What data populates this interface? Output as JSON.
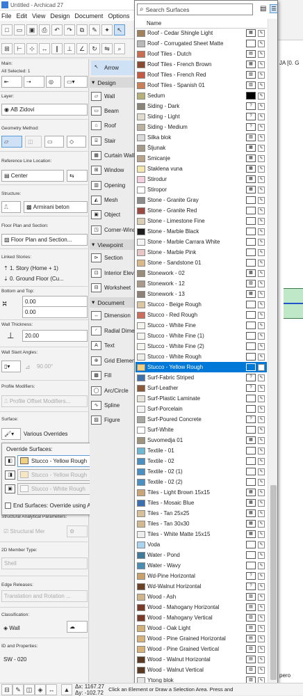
{
  "app": {
    "title": "Untitled - Archicad 27",
    "menus": [
      "File",
      "Edit",
      "View",
      "Design",
      "Document",
      "Options"
    ]
  },
  "info": {
    "main": "Main:",
    "all_selected": "All Selected: 1",
    "layer_label": "Layer:",
    "layer": "AB Zidovi",
    "geometry_label": "Geometry Method:",
    "refline_label": "Reference Line Location:",
    "refline": "Center",
    "structure_label": "Structure:",
    "structure": "Armirani beton",
    "floorplan_label": "Floor Plan and Section:",
    "floorplan": "Floor Plan and Section...",
    "linked_label": "Linked Stories:",
    "linked1": "1. Story (Home + 1)",
    "linked2": "0. Ground Floor (Cu...",
    "bottomtop_label": "Bottom and Top:",
    "top_value": "0.00",
    "bottom_value": "0.00",
    "thickness_label": "Wall Thickness:",
    "thickness": "20.00",
    "slant_label": "Wall Slant Angles:",
    "slant": "90.00°",
    "profile_label": "Profile Modifiers:",
    "profile": "Profile Offset Modifiers...",
    "surface_label": "Surface:",
    "surface": "Various Overrides",
    "structural_label": "Structural Analytical Parameters:",
    "structural": "Structural Member",
    "member2d_label": "2D Member Type:",
    "member2d": "Shell",
    "edge_label": "Edge Releases:",
    "edge": "Translation and Rotation ...",
    "class_label": "Classification:",
    "class": "Wall",
    "id_label": "ID and Properties:",
    "id": "SW - 020"
  },
  "overrides": {
    "title": "Override Surfaces:",
    "s1": "Stucco - Yellow Rough",
    "s2": "Stucco - Yellow Rough",
    "s3": "Stucco - White Rough",
    "end": "End Surfaces: Override using Adjoining Walls"
  },
  "toolbox": {
    "arrow": "Arrow",
    "design": "Design",
    "wall": "Wall",
    "beam": "Beam",
    "roof": "Roof",
    "stair": "Stair",
    "curtain": "Curtain Wall",
    "window": "Window",
    "opening": "Opening",
    "mesh": "Mesh",
    "object": "Object",
    "corner": "Corner-Window",
    "viewpoint": "Viewpoint",
    "section": "Section",
    "interior": "Interior Elevation",
    "worksheet": "Worksheet",
    "document": "Document",
    "dimension": "Dimension",
    "radial": "Radial Dimension",
    "text": "Text",
    "grid": "Grid Element",
    "fill": "Fill",
    "arc": "Arc/Circle",
    "spline": "Spline",
    "figure": "Figure"
  },
  "status": {
    "dx": "Δx: 1167.27",
    "dy": "Δy: -102.72",
    "message": "Click an Element or Draw a Selection Area. Press and"
  },
  "right": {
    "ja": "JA [0. G",
    "pero": "pero"
  },
  "surfaces": {
    "placeholder": "Search Surfaces",
    "header": "Name",
    "items": [
      {
        "name": "Roof - Cedar Shingle Light",
        "color": "#a0815b",
        "pattern": "▦"
      },
      {
        "name": "Roof - Corrugated Sheet Matte",
        "color": "#b9b9b9",
        "pattern": ""
      },
      {
        "name": "Roof Tiles - Dutch",
        "color": "#c86e50",
        "pattern": "▤"
      },
      {
        "name": "Roof Tiles - French Brown",
        "color": "#8a4a32",
        "pattern": "▦"
      },
      {
        "name": "Roof Tiles - French Red",
        "color": "#c25a45",
        "pattern": "▧"
      },
      {
        "name": "Roof Tiles - Spanish 01",
        "color": "#c9805b",
        "pattern": "▥"
      },
      {
        "name": "Sedum",
        "color": "#b5b07a",
        "pattern": "■"
      },
      {
        "name": "Siding - Dark",
        "color": "#8a8478",
        "pattern": "?"
      },
      {
        "name": "Siding - Light",
        "color": "#e0dccf",
        "pattern": "?"
      },
      {
        "name": "Siding - Medium",
        "color": "#b9b2a3",
        "pattern": "?"
      },
      {
        "name": "Silka blok",
        "color": "#d9d9d9",
        "pattern": "▨"
      },
      {
        "name": "Šljunak",
        "color": "#a59b8a",
        "pattern": "▩"
      },
      {
        "name": "Smicanje",
        "color": "#b8a48a",
        "pattern": "▦"
      },
      {
        "name": "Staklena vuna",
        "color": "#f4e8b0",
        "pattern": "▩"
      },
      {
        "name": "Stirodur",
        "color": "#f2d0e0",
        "pattern": "▦"
      },
      {
        "name": "Stiropor",
        "color": "#ffffff",
        "pattern": "▦"
      },
      {
        "name": "Stone - Granite Gray",
        "color": "#8c8c8c",
        "pattern": ""
      },
      {
        "name": "Stone - Granite Red",
        "color": "#9a4a42",
        "pattern": ""
      },
      {
        "name": "Stone - Limestone Fine",
        "color": "#d8cfb6",
        "pattern": ""
      },
      {
        "name": "Stone - Marble Black",
        "color": "#1e1e1e",
        "pattern": ""
      },
      {
        "name": "Stone - Marble Carrara White",
        "color": "#f4f4f4",
        "pattern": ""
      },
      {
        "name": "Stone - Marble Pink",
        "color": "#e8c6c6",
        "pattern": ""
      },
      {
        "name": "Stone - Sandstone 01",
        "color": "#d9b98a",
        "pattern": ""
      },
      {
        "name": "Stonework - 02",
        "color": "#9a8c7a",
        "pattern": "▩"
      },
      {
        "name": "Stonework - 12",
        "color": "#a89a8a",
        "pattern": "▧"
      },
      {
        "name": "Stonework - 13",
        "color": "#8d8275",
        "pattern": "▦"
      },
      {
        "name": "Stucco - Beige Rough",
        "color": "#d8c7a2",
        "pattern": ""
      },
      {
        "name": "Stucco - Red Rough",
        "color": "#c86e5a",
        "pattern": ""
      },
      {
        "name": "Stucco - White Fine",
        "color": "#f5f5f0",
        "pattern": ""
      },
      {
        "name": "Stucco - White Fine (1)",
        "color": "#f5f5f0",
        "pattern": ""
      },
      {
        "name": "Stucco - White Fine (2)",
        "color": "#f5f5f0",
        "pattern": ""
      },
      {
        "name": "Stucco - White Rough",
        "color": "#eeeeea",
        "pattern": ""
      },
      {
        "name": "Stucco - Yellow Rough",
        "color": "#f3cf82",
        "pattern": "",
        "selected": true
      },
      {
        "name": "Surf-Fabric Striped",
        "color": "#3f6fa8",
        "pattern": "?"
      },
      {
        "name": "Surf-Leather",
        "color": "#8a5a3a",
        "pattern": "?"
      },
      {
        "name": "Surf-Plastic Laminate",
        "color": "#e8e4dc",
        "pattern": ""
      },
      {
        "name": "Surf-Porcelain",
        "color": "#f3f3f3",
        "pattern": ""
      },
      {
        "name": "Surf-Poured Concrete",
        "color": "#a9a9a4",
        "pattern": "?"
      },
      {
        "name": "Surf-White",
        "color": "#ffffff",
        "pattern": ""
      },
      {
        "name": "Suvomedja 01",
        "color": "#9e9480",
        "pattern": "▦"
      },
      {
        "name": "Textile - 01",
        "color": "#6fb8d4",
        "pattern": ""
      },
      {
        "name": "Textile - 02",
        "color": "#4a8fc0",
        "pattern": ""
      },
      {
        "name": "Textile - 02 (1)",
        "color": "#4a8fc0",
        "pattern": ""
      },
      {
        "name": "Textile - 02 (2)",
        "color": "#4a8fc0",
        "pattern": ""
      },
      {
        "name": "Tiles - Light Brown 15x15",
        "color": "#c9a67a",
        "pattern": "▦"
      },
      {
        "name": "Tiles - Mosaic Blue",
        "color": "#3a6fb0",
        "pattern": "▩"
      },
      {
        "name": "Tiles - Tan 25x25",
        "color": "#d6bf99",
        "pattern": "▦"
      },
      {
        "name": "Tiles - Tan 30x30",
        "color": "#d2b890",
        "pattern": "▦"
      },
      {
        "name": "Tiles - White Matte 15x15",
        "color": "#eeeeee",
        "pattern": "▦"
      },
      {
        "name": "Voda",
        "color": "#a9d4f0",
        "pattern": ""
      },
      {
        "name": "Water - Pond",
        "color": "#3f7a9a",
        "pattern": ""
      },
      {
        "name": "Water - Wavy",
        "color": "#4a8bb0",
        "pattern": ""
      },
      {
        "name": "Wd-Pine Horizontal",
        "color": "#c8a06a",
        "pattern": "?"
      },
      {
        "name": "Wd-Walnut Horizontal",
        "color": "#6b4226",
        "pattern": "?"
      },
      {
        "name": "Wood - Ash",
        "color": "#cdb48c",
        "pattern": "▨"
      },
      {
        "name": "Wood - Mahogany Horizontal",
        "color": "#7a3a28",
        "pattern": "▤"
      },
      {
        "name": "Wood - Mahogany Vertical",
        "color": "#7a3a28",
        "pattern": "▥"
      },
      {
        "name": "Wood - Oak Light",
        "color": "#d2b07a",
        "pattern": "▤"
      },
      {
        "name": "Wood - Pine Grained Horizontal",
        "color": "#d6b27a",
        "pattern": "▤"
      },
      {
        "name": "Wood - Pine Grained Vertical",
        "color": "#d6b27a",
        "pattern": "▥"
      },
      {
        "name": "Wood - Walnut Horizontal",
        "color": "#5a3a22",
        "pattern": "▤"
      },
      {
        "name": "Wood - Walnut Vertical",
        "color": "#5a3a22",
        "pattern": "▥"
      },
      {
        "name": "Ytong blok",
        "color": "#e6e6e6",
        "pattern": "▨"
      }
    ]
  }
}
